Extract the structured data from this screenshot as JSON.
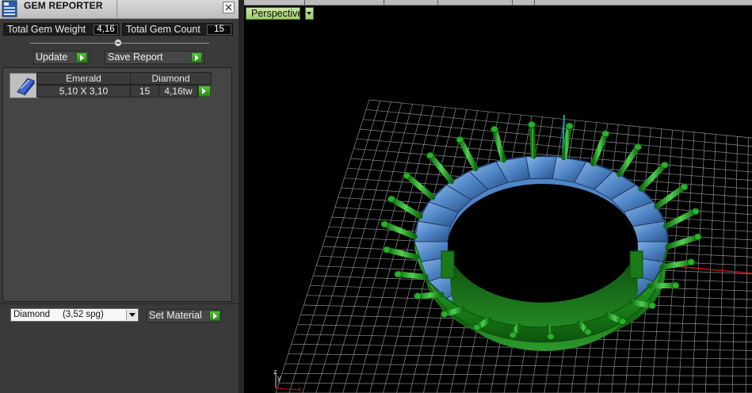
{
  "panel": {
    "title": "GEM REPORTER",
    "close_symbol": "✕",
    "total_weight_label": "Total Gem Weight",
    "total_weight_value": "4,16",
    "total_count_label": "Total Gem Count",
    "total_count_value": "15",
    "update_label": "Update",
    "save_report_label": "Save Report",
    "table": {
      "gem_type": "Emerald",
      "material": "Diamond",
      "size": "5,10 X 3,10",
      "count": "15",
      "weight": "4,16tw"
    },
    "material_select_value": "Diamond     (3,52 spg)",
    "set_material_label": "Set Material"
  },
  "viewport": {
    "view_label": "Perspective",
    "grid_color": "#8c8c8c",
    "axis_x_color": "#c21414",
    "axis_y_color": "#1e9fb0",
    "band_color": "#1f8a1f",
    "gem_color": "#4f86c6",
    "prong_color": "#2bb02b"
  },
  "colors": {
    "accent_green": "#3aa623",
    "panel_bg": "#3a3a3a"
  }
}
